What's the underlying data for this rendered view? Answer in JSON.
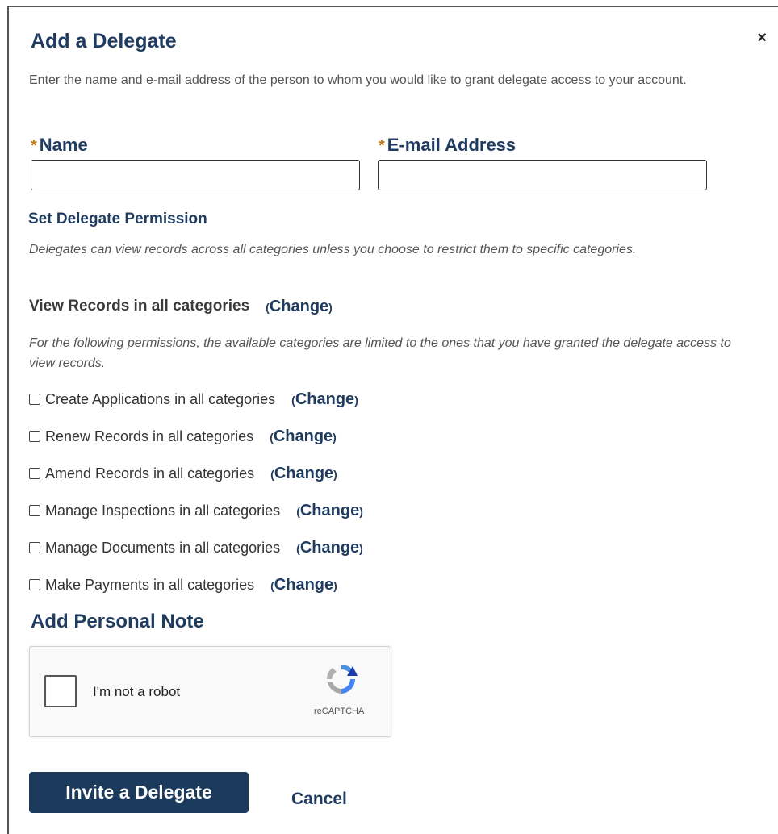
{
  "background": {
    "partial_text": "…"
  },
  "dialog": {
    "title": "Add a Delegate",
    "close_glyph": "×",
    "intro": "Enter the name and e-mail address of the person to whom you would like to grant delegate access to your account."
  },
  "fields": {
    "required_marker": "*",
    "name_label": "Name",
    "email_label": "E-mail Address",
    "name_value": "",
    "email_value": ""
  },
  "permissions": {
    "heading": "Set Delegate Permission",
    "note": "Delegates can view records across all categories unless you choose to restrict them to specific categories.",
    "view_label": "View Records in all categories",
    "change_open": "(",
    "change_label": "Change",
    "change_close": ")",
    "limited_note": "For the following permissions, the available categories are limited to the ones that you have granted the delegate access to view records.",
    "items": [
      {
        "label": "Create Applications in all categories",
        "checked": false
      },
      {
        "label": "Renew Records in all categories",
        "checked": false
      },
      {
        "label": "Amend Records in all categories",
        "checked": false
      },
      {
        "label": "Manage Inspections in all categories",
        "checked": false
      },
      {
        "label": "Manage Documents in all categories",
        "checked": false
      },
      {
        "label": "Make Payments in all categories",
        "checked": false
      }
    ]
  },
  "personal_note": {
    "heading": "Add Personal Note"
  },
  "recaptcha": {
    "label": "I'm not a robot",
    "brand": "reCAPTCHA",
    "checked": false
  },
  "actions": {
    "invite_label": "Invite a Delegate",
    "cancel_label": "Cancel"
  },
  "colors": {
    "primary": "#1f3b5f",
    "button": "#1b3a5c",
    "required": "#c07a1c",
    "text": "#333333"
  },
  "icons": {
    "close": "close-icon",
    "recaptcha_logo": "recaptcha-logo-icon"
  }
}
